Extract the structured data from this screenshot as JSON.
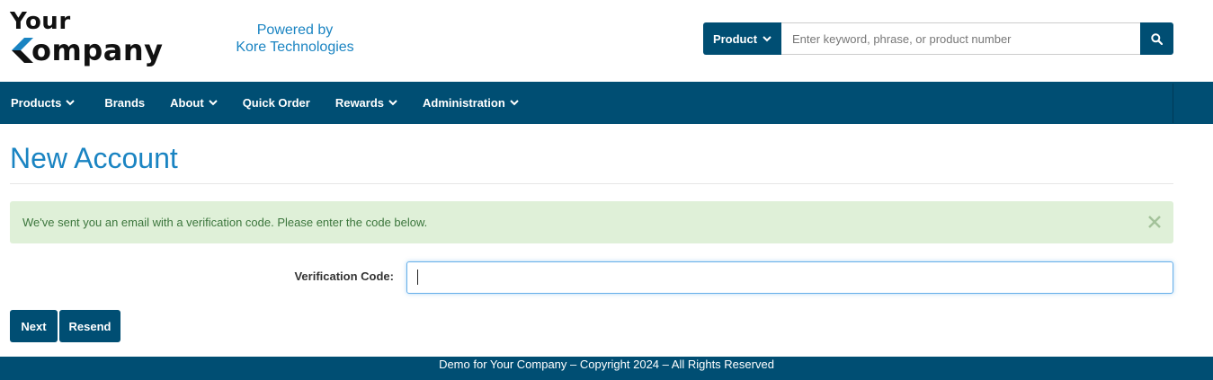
{
  "header": {
    "logo": {
      "line1": "Your",
      "line2": "ompany"
    },
    "powered_by": {
      "line1": "Powered by",
      "line2": "Kore Technologies"
    },
    "search": {
      "type_label": "Product",
      "placeholder": "Enter keyword, phrase, or product number",
      "search_icon": "search-icon"
    }
  },
  "nav": {
    "items": [
      {
        "label": "Products",
        "has_dropdown": true
      },
      {
        "label": "Brands",
        "has_dropdown": false
      },
      {
        "label": "About",
        "has_dropdown": true
      },
      {
        "label": "Quick Order",
        "has_dropdown": false
      },
      {
        "label": "Rewards",
        "has_dropdown": true
      },
      {
        "label": "Administration",
        "has_dropdown": true
      }
    ]
  },
  "main": {
    "title": "New Account",
    "alert": {
      "message": "We've sent you an email with a verification code. Please enter the code below.",
      "close_icon": "close-icon"
    },
    "form": {
      "verification_label": "Verification Code:",
      "verification_value": ""
    },
    "buttons": {
      "next": "Next",
      "resend": "Resend"
    }
  },
  "footer": {
    "text": "Demo for Your Company – Copyright 2024 – All Rights Reserved"
  },
  "colors": {
    "brand_dark": "#004e73",
    "brand_blue": "#1a84c2",
    "alert_bg": "#dff0d8",
    "alert_text": "#3c763d",
    "logo_accent": "#1a84c2"
  }
}
